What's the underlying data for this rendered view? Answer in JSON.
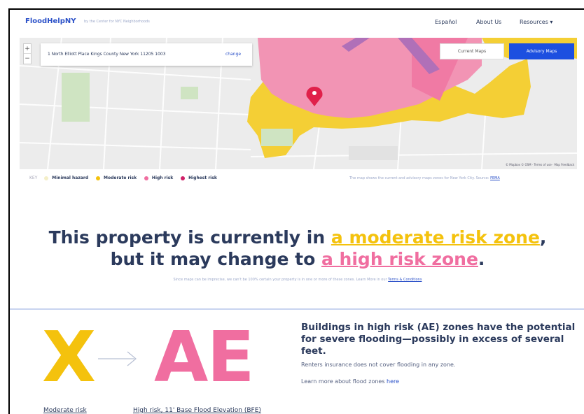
{
  "header": {
    "logo": "FloodHelpNY",
    "tagline": "by the Center for NYC Neighborhoods",
    "nav": {
      "espanol": "Español",
      "about": "About Us",
      "resources": "Resources ▾"
    }
  },
  "map": {
    "zoom_in": "+",
    "zoom_out": "−",
    "address": "1 North Elliott Place Kings County New York 11205 1003",
    "change_label": "change",
    "current_maps_label": "Current Maps",
    "advisory_maps_label": "Advisory Maps",
    "attribution": "© Mapbox © OSM · Terms of use · Map Feedback"
  },
  "legend": {
    "key_label": "KEY",
    "items": [
      {
        "label": "Minimal hazard",
        "color": "#f4efc8"
      },
      {
        "label": "Moderate risk",
        "color": "#f4c20d"
      },
      {
        "label": "High risk",
        "color": "#f06ea0"
      },
      {
        "label": "Highest risk",
        "color": "#d02068"
      }
    ],
    "note_text": "The map shows the current and advisory maps zones for New York City. Source: ",
    "note_link": "FEMA"
  },
  "headline": {
    "part1": "This property is currently in ",
    "moderate_link": "a moderate risk zone",
    "part2": ",",
    "part3": "but it may change to ",
    "high_link": "a high risk zone",
    "part4": "."
  },
  "disclaimer": {
    "text": "Since maps can be imprecise, we can't be 100% certain your property is in one or more of these zones. Learn More in our ",
    "link": "Terms & Conditions"
  },
  "zones": {
    "current_code": "X",
    "future_code": "AE",
    "current_label": "Moderate risk",
    "future_label": "High risk, 11' Base Flood Elevation (BFE)"
  },
  "info": {
    "title": "Buildings in high risk (AE) zones have the potential for severe flooding—possibly in excess of several feet.",
    "renters": "Renters insurance does not cover flooding in any zone.",
    "learn_text": "Learn more about flood zones ",
    "learn_link": "here"
  },
  "colors": {
    "brand_blue": "#2a50c8",
    "advisory_blue": "#1c4fe0",
    "moderate": "#f4c20d",
    "high": "#f06ea0",
    "text": "#2b3a5c"
  }
}
